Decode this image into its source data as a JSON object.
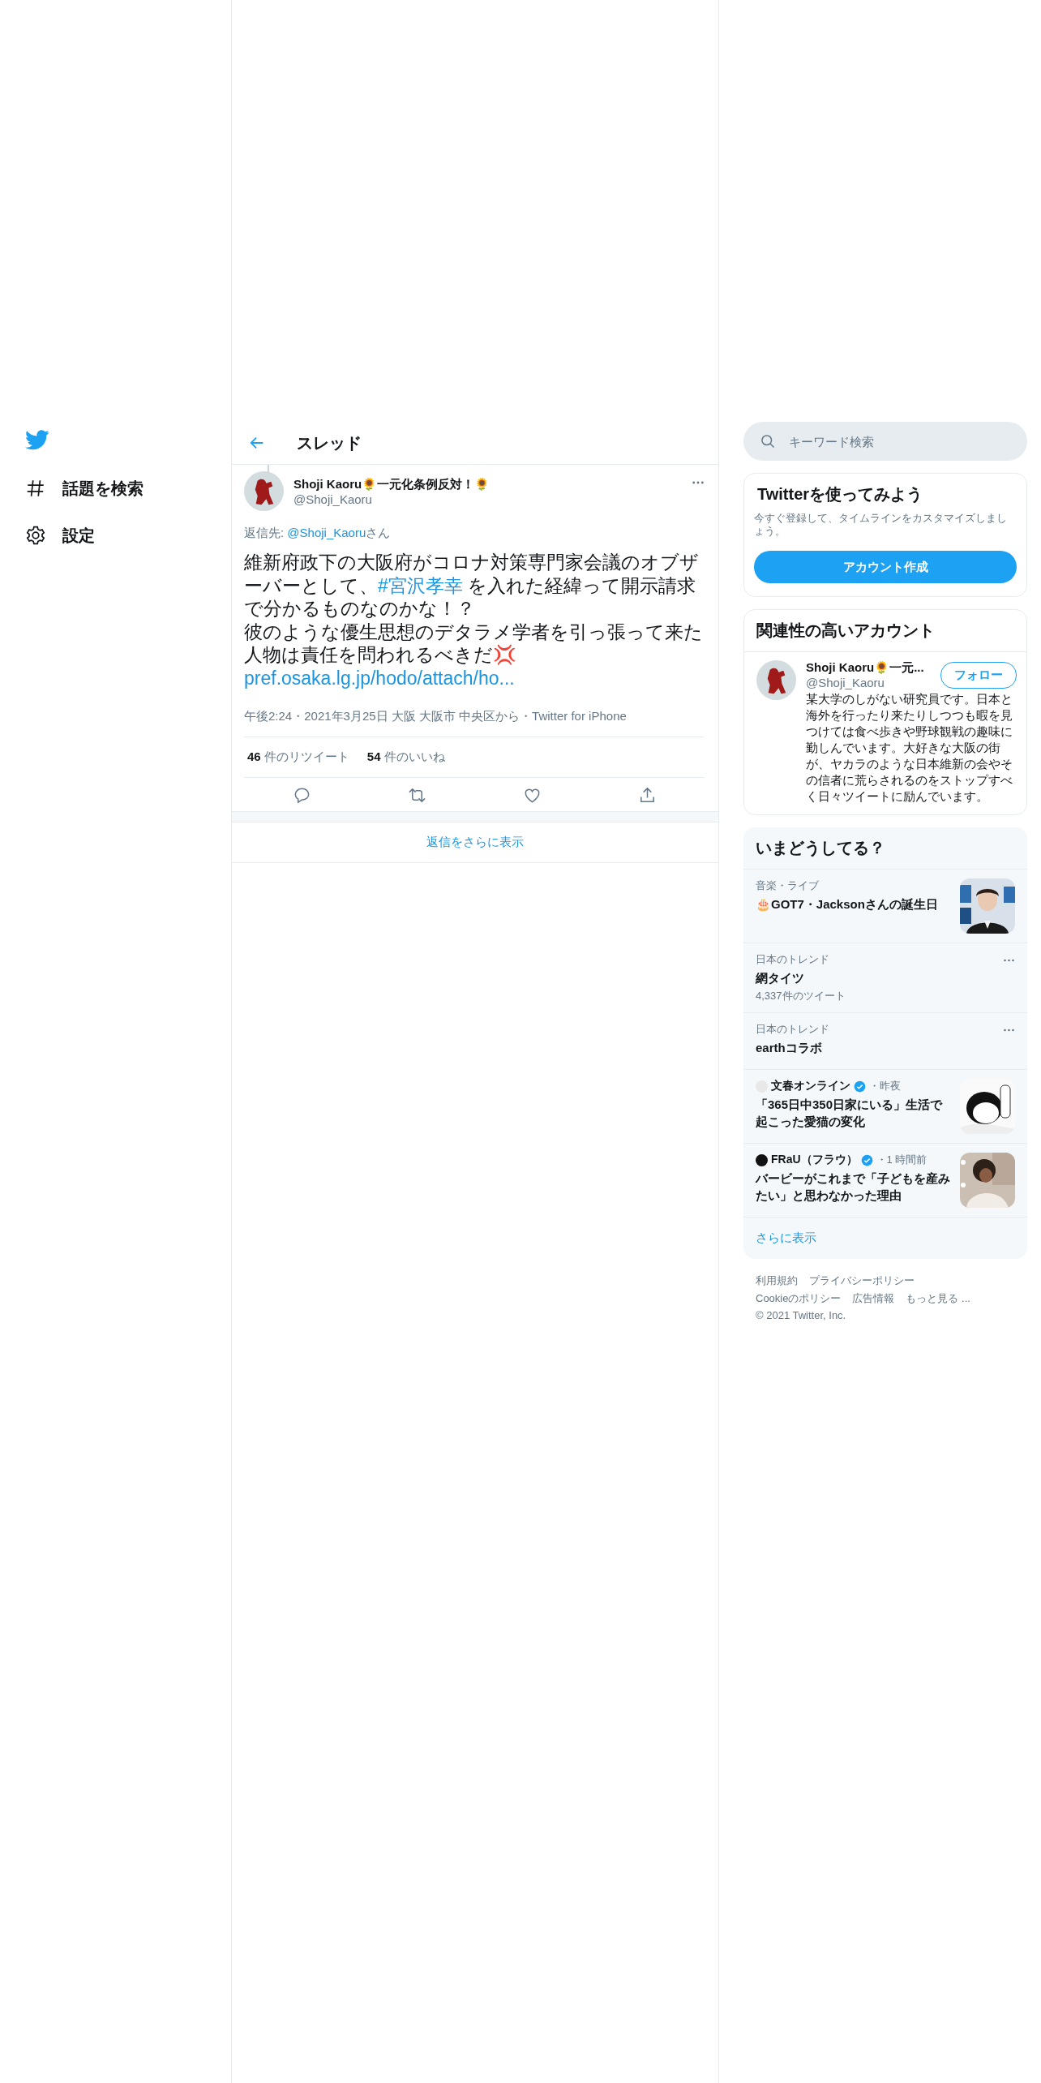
{
  "sidebar": {
    "items": [
      {
        "kind": "explore",
        "label": "話題を検索"
      },
      {
        "kind": "settings",
        "label": "設定"
      }
    ]
  },
  "header": {
    "title": "スレッド"
  },
  "tweet": {
    "author": {
      "name": "Shoji Kaoru🌻一元化条例反対！🌻",
      "handle": "@Shoji_Kaoru"
    },
    "reply_to": {
      "prefix": "返信先: ",
      "handle": "@Shoji_Kaoru",
      "suffix": "さん"
    },
    "body": [
      {
        "segments": [
          {
            "kind": "text",
            "text": "維新府政下の大阪府がコロナ対策専門家会議のオブザーバーとして、"
          },
          {
            "kind": "hashtag",
            "text": "#宮沢孝幸"
          },
          {
            "kind": "text",
            "text": " を入れた経緯って開示請求で分かるものなのかな！？"
          }
        ]
      },
      {
        "segments": [
          {
            "kind": "text",
            "text": "彼のような優生思想のデタラメ学者を引っ張って来た人物は責任を問われるべきだ💢"
          }
        ]
      },
      {
        "segments": [
          {
            "kind": "link",
            "text": "pref.osaka.lg.jp/hodo/attach/ho..."
          }
        ]
      }
    ],
    "meta": "午後2:24・2021年3月25日 大阪 大阪市 中央区から・Twitter for iPhone",
    "stats": [
      {
        "count": "46",
        "label": "件のリツイート"
      },
      {
        "count": "54",
        "label": "件のいいね"
      }
    ],
    "actions": [
      {
        "kind": "reply"
      },
      {
        "kind": "retweet"
      },
      {
        "kind": "like"
      },
      {
        "kind": "share"
      }
    ]
  },
  "show_more_replies": "返信をさらに表示",
  "search": {
    "placeholder": "キーワード検索"
  },
  "signup": {
    "title": "Twitterを使ってみよう",
    "text": "今すぐ登録して、タイムラインをカスタマイズしましょう。",
    "button": "アカウント作成"
  },
  "related": {
    "title": "関連性の高いアカウント",
    "accounts": [
      {
        "name": "Shoji Kaoru🌻一元...",
        "handle": "@Shoji_Kaoru",
        "follow": "フォロー",
        "bio": "某大学のしがない研究員です。日本と海外を行ったり来たりしつつも暇を見つけては食べ歩きや野球観戦の趣味に勤しんでいます。大好きな大阪の街が、ヤカラのような日本維新の会やその信者に荒らされるのをストップすべく日々ツイートに励んでいます。"
      }
    ]
  },
  "trends": {
    "title": "いまどうしてる？",
    "items": [
      {
        "kind": "topic",
        "context": "音楽・ライブ",
        "title": "🎂GOT7・Jacksonさんの誕生日",
        "picture": true
      },
      {
        "kind": "trend",
        "context": "日本のトレンド",
        "title": "網タイツ",
        "count": "4,337件のツイート"
      },
      {
        "kind": "trend",
        "context": "日本のトレンド",
        "title": "earthコラボ"
      },
      {
        "kind": "news",
        "source": "文春オンライン",
        "verified": true,
        "time": "・昨夜",
        "title": "「365日中350日家にいる」生活で起こった愛猫の変化",
        "picture": true
      },
      {
        "kind": "news",
        "source": "FRaU（フラウ）",
        "verified": true,
        "time": "・1 時間前",
        "title": "バービーがこれまで「子どもを産みたい」と思わなかった理由",
        "picture": true
      }
    ],
    "show_more": "さらに表示"
  },
  "footer": {
    "rows": [
      [
        "利用規約",
        "プライバシーポリシー"
      ],
      [
        "Cookieのポリシー",
        "広告情報",
        "もっと見る ..."
      ]
    ],
    "copyright": "© 2021 Twitter, Inc."
  }
}
